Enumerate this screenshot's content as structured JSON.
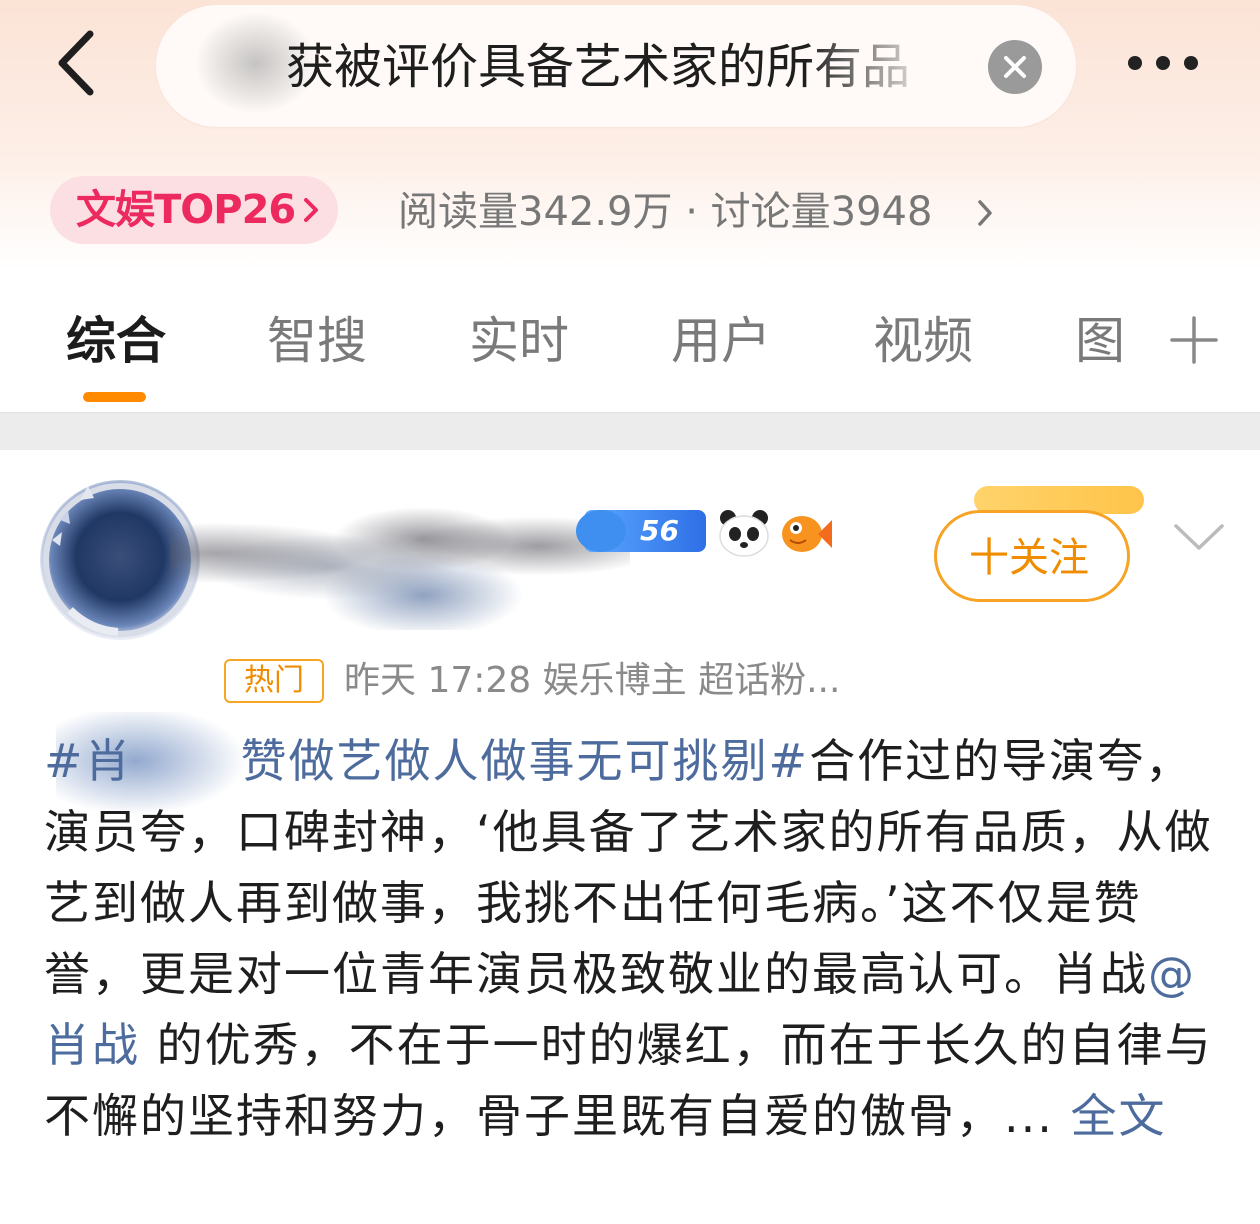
{
  "header": {
    "search_text": "获被评价具备艺术家的所有品",
    "rank_badge": "文娱TOP26",
    "stats": "阅读量342.9万 · 讨论量3948"
  },
  "tabs": [
    {
      "label": "综合"
    },
    {
      "label": "智搜"
    },
    {
      "label": "实时"
    },
    {
      "label": "用户"
    },
    {
      "label": "视频"
    },
    {
      "label": "图"
    }
  ],
  "post": {
    "level_badge": "56",
    "follow_label": "十关注",
    "hot_label": "热门",
    "meta": "昨天 17:28   娱乐博主 超话粉...",
    "content": {
      "tag_prefix": "#肖",
      "tag_rest": "赞做艺做人做事无可挑剔#",
      "part1": "合作过的导演夸，演员夸，口碑封神，‘他具备了艺术家的所有品质，从做艺到做人再到做事，我挑不出任何毛病。’这不仅是赞誉，更是对一位青年演员极致敬业的最高认可。肖战",
      "mention": "@肖战",
      "part2": " 的优秀，不在于一时的爆红，而在于长久的自律与不懈的坚持和努力，骨子里既有自爱的傲骨，...",
      "more": " 全文"
    }
  },
  "colors": {
    "accent_orange": "#ff8a00",
    "rank_pink": "#ec2a5f",
    "link_blue": "#4d6c9d"
  },
  "icons": [
    "back-arrow-icon",
    "clear-icon",
    "more-icon",
    "chevron-right-icon",
    "add-tab-icon",
    "panda-icon",
    "fish-icon",
    "chevron-down-icon"
  ]
}
